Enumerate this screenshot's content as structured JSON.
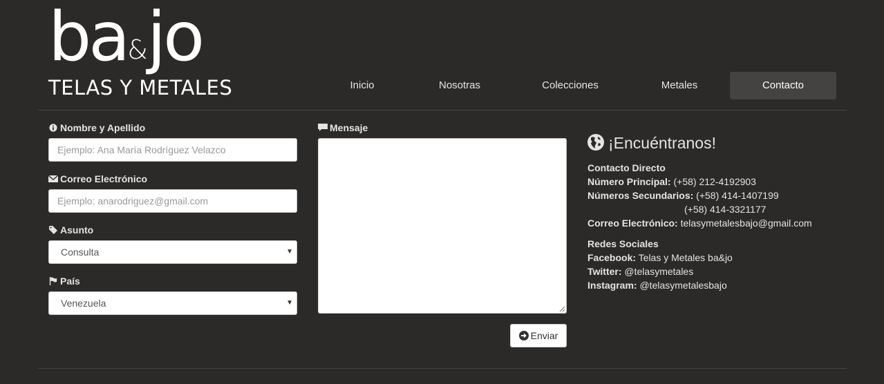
{
  "brand": {
    "logo_main": "ba",
    "logo_amp": "&",
    "logo_end": "jo",
    "logo_sub": "TELAS Y METALES"
  },
  "nav": {
    "items": [
      {
        "label": "Inicio"
      },
      {
        "label": "Nosotras"
      },
      {
        "label": "Colecciones"
      },
      {
        "label": "Metales"
      },
      {
        "label": "Contacto",
        "active": true
      }
    ]
  },
  "form": {
    "name_label": "Nombre y Apellido",
    "name_placeholder": "Ejemplo: Ana María Rodríguez Velazco",
    "email_label": "Correo Electrónico",
    "email_placeholder": "Ejemplo: anarodriguez@gmail.com",
    "subject_label": "Asunto",
    "subject_value": "Consulta",
    "country_label": "País",
    "country_value": "Venezuela",
    "message_label": "Mensaje",
    "submit_label": "Enviar"
  },
  "contact": {
    "title": "¡Encuéntranos!",
    "direct_heading": "Contacto Directo",
    "main_phone_label": "Número Principal:",
    "main_phone": "(+58) 212-4192903",
    "secondary_label": "Números Secundarios:",
    "secondary_phone_1": "(+58) 414-1407199",
    "secondary_phone_2": "(+58) 414-3321177",
    "email_label": "Correo Electrónico:",
    "email": "telasymetalesbajo@gmail.com",
    "social_heading": "Redes Sociales",
    "facebook_label": "Facebook:",
    "facebook": "Telas y Metales ba&jo",
    "twitter_label": "Twitter:",
    "twitter": "@telasymetales",
    "instagram_label": "Instagram:",
    "instagram": "@telasymetalesbajo"
  },
  "colors": {
    "background": "#2c2a29",
    "nav_active": "#444342",
    "text": "#e6e4e2"
  },
  "icons": {
    "name": "info-icon",
    "email": "envelope-icon",
    "subject": "tag-icon",
    "country": "flag-icon",
    "message": "comment-icon",
    "submit": "arrow-circle-right-icon",
    "contact": "globe-icon"
  }
}
